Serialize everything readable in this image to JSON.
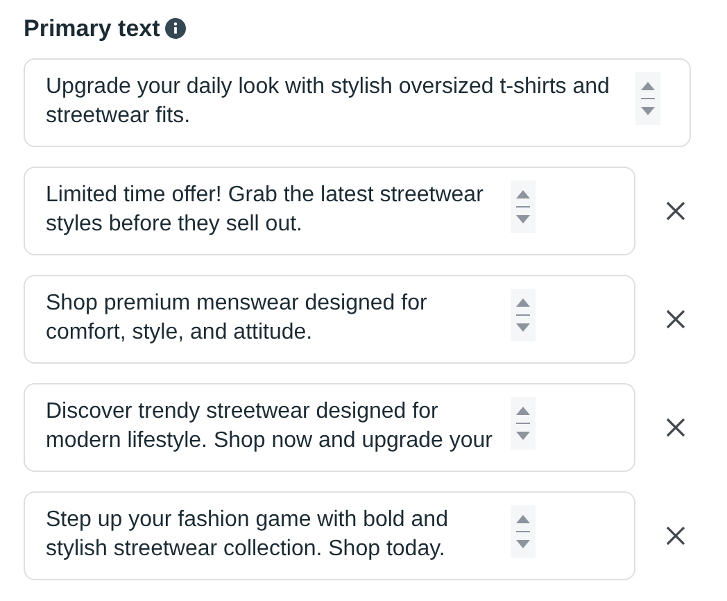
{
  "section": {
    "title": "Primary text",
    "info_icon": true
  },
  "fields": [
    {
      "text": "Upgrade your daily look with stylish oversized t-shirts and streetwear fits.",
      "removable": false
    },
    {
      "text": "Limited time offer! Grab the latest streetwear styles before they sell out.",
      "removable": true
    },
    {
      "text": "Shop premium menswear designed for comfort, style, and attitude.",
      "removable": true
    },
    {
      "text": "Discover trendy streetwear designed for modern lifestyle. Shop now and upgrade your",
      "removable": true
    },
    {
      "text": "Step up your fashion game with bold and stylish streetwear collection. Shop today.",
      "removable": true
    }
  ]
}
